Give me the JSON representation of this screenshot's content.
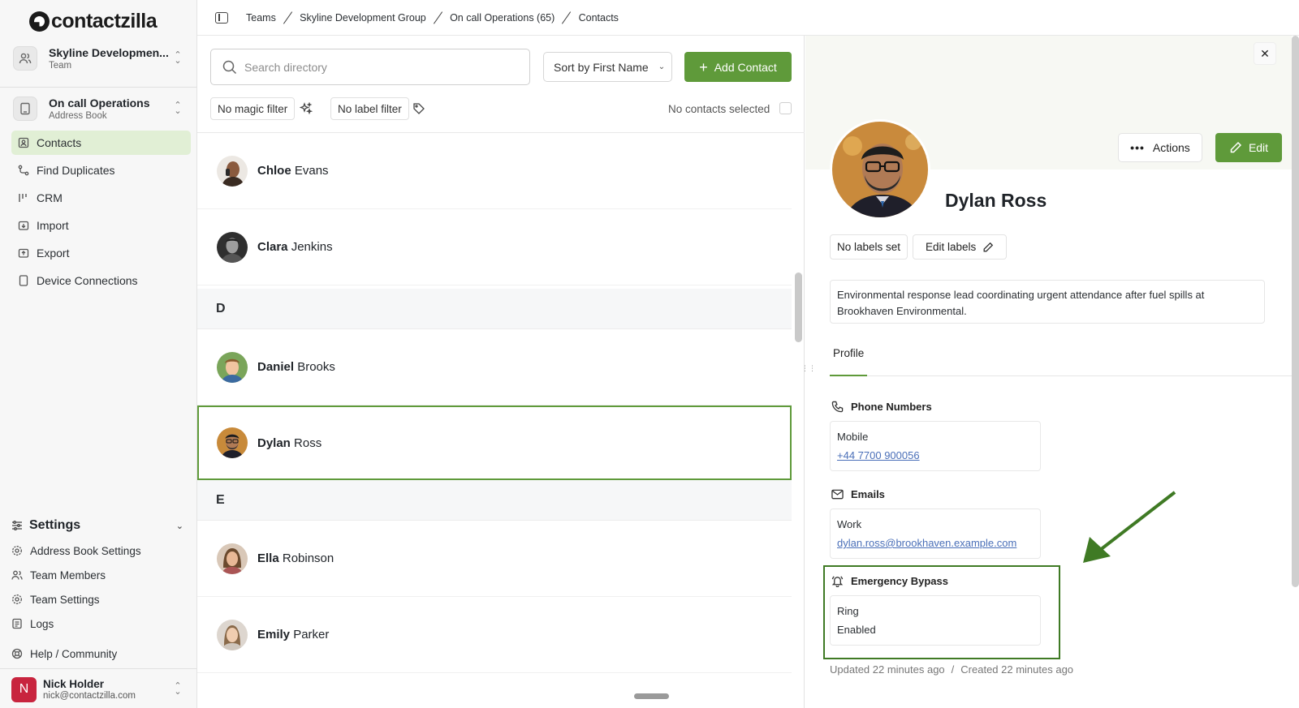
{
  "brand": {
    "name": "contactzilla"
  },
  "team_switcher": {
    "title": "Skyline Developmen...",
    "subtitle": "Team"
  },
  "book_switcher": {
    "title": "On call Operations",
    "subtitle": "Address Book"
  },
  "nav": [
    {
      "label": "Contacts",
      "icon": "contacts-icon",
      "active": true
    },
    {
      "label": "Find Duplicates",
      "icon": "duplicates-icon"
    },
    {
      "label": "CRM",
      "icon": "crm-icon"
    },
    {
      "label": "Import",
      "icon": "import-icon"
    },
    {
      "label": "Export",
      "icon": "export-icon"
    },
    {
      "label": "Device Connections",
      "icon": "device-icon"
    }
  ],
  "settings": {
    "title": "Settings",
    "items": [
      {
        "label": "Address Book Settings",
        "icon": "gear-icon"
      },
      {
        "label": "Team Members",
        "icon": "users-icon"
      },
      {
        "label": "Team Settings",
        "icon": "gear-icon"
      },
      {
        "label": "Logs",
        "icon": "logs-icon"
      },
      {
        "label": "Help / Community",
        "icon": "help-icon"
      }
    ]
  },
  "user": {
    "initial": "N",
    "name": "Nick Holder",
    "email": "nick@contactzilla.com"
  },
  "breadcrumb": [
    "Teams",
    "Skyline Development Group",
    "On call Operations (65)",
    "Contacts"
  ],
  "search": {
    "placeholder": "Search directory",
    "value": ""
  },
  "sort": {
    "label": "Sort by First Name"
  },
  "add_contact": {
    "label": "Add Contact"
  },
  "filters": {
    "magic": "No magic filter",
    "label": "No label filter"
  },
  "selection": {
    "text": "No contacts selected"
  },
  "contacts": [
    {
      "first": "Chloe",
      "last": "Evans"
    },
    {
      "first": "Clara",
      "last": "Jenkins"
    },
    {
      "letter": "D"
    },
    {
      "first": "Daniel",
      "last": "Brooks"
    },
    {
      "first": "Dylan",
      "last": "Ross",
      "selected": true
    },
    {
      "letter": "E"
    },
    {
      "first": "Ella",
      "last": "Robinson"
    },
    {
      "first": "Emily",
      "last": "Parker"
    }
  ],
  "detail": {
    "name": "Dylan Ross",
    "actions_label": "Actions",
    "edit_label": "Edit",
    "labels_status": "No labels set",
    "edit_labels": "Edit labels",
    "bio": "Environmental response lead coordinating urgent attendance after fuel spills at Brookhaven Environmental.",
    "tab": "Profile",
    "phone": {
      "heading": "Phone Numbers",
      "type": "Mobile",
      "value": "+44 7700 900056"
    },
    "email": {
      "heading": "Emails",
      "type": "Work",
      "value": "dylan.ross@brookhaven.example.com"
    },
    "bypass": {
      "heading": "Emergency Bypass",
      "type": "Ring",
      "value": "Enabled"
    },
    "updated": "Updated 22 minutes ago",
    "separator": "/",
    "created": "Created 22 minutes ago"
  },
  "colors": {
    "accent": "#5f9a3a",
    "highlight": "#3f7a24",
    "active_nav": "#e1efd5"
  }
}
